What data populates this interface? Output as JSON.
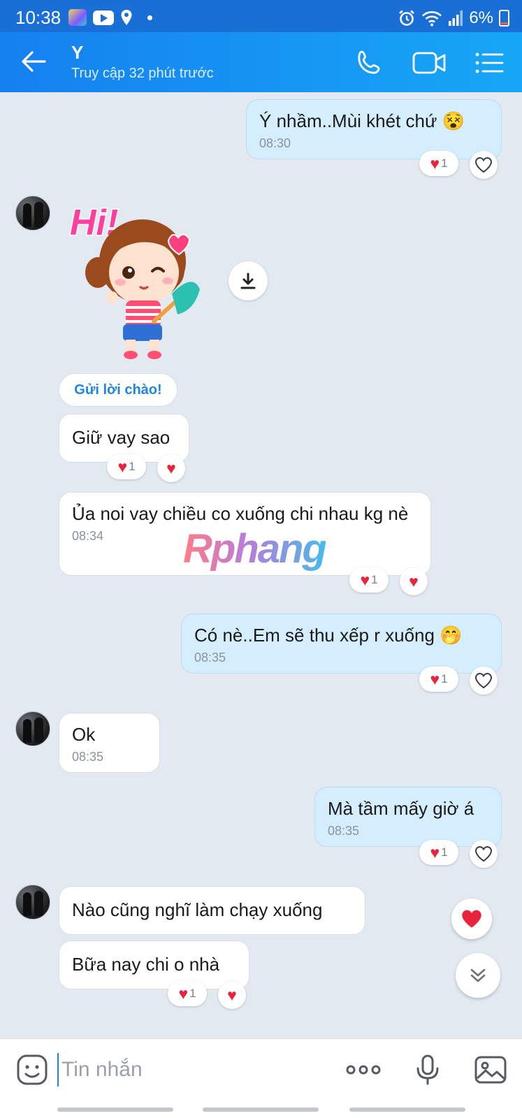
{
  "status_bar": {
    "time": "10:38",
    "battery": "6%"
  },
  "header": {
    "name": "Y",
    "status": "Truy cập 32 phút trước"
  },
  "messages": [
    {
      "text": "Ý nhầm..Mùi khét chứ 😵",
      "time": "08:30",
      "react_count": "1"
    },
    {
      "text": "Giữ vay sao",
      "react_count": "1"
    },
    {
      "text": "Ủa noi vay chiều co xuống chi nhau kg nè",
      "time": "08:34",
      "react_count": "1"
    },
    {
      "text": "Có nè..Em sẽ thu xếp r xuống 🤭",
      "time": "08:35",
      "react_count": "1"
    },
    {
      "text": "Ok",
      "time": "08:35"
    },
    {
      "text": "Mà tầm mấy giờ á",
      "time": "08:35",
      "react_count": "1"
    },
    {
      "text": "Nào cũng nghĩ làm chạy xuống"
    },
    {
      "text": "Bữa nay chi o nhà",
      "react_count": "1"
    }
  ],
  "sticker": {
    "text": "Hi!"
  },
  "hello_button": "Gửi lời chào!",
  "watermark": "Rphang",
  "input": {
    "placeholder": "Tin nhắn"
  },
  "colors": {
    "header": "#1580ef",
    "outgoing": "#d5eefe",
    "incoming": "#ffffff",
    "heart": "#e8243d",
    "accent": "#1f86de"
  },
  "icons": [
    "back-arrow-icon",
    "phone-icon",
    "video-call-icon",
    "menu-list-icon",
    "download-icon",
    "heart-icon",
    "scroll-down-icon",
    "emoji-icon",
    "more-icon",
    "microphone-icon",
    "gallery-icon"
  ]
}
